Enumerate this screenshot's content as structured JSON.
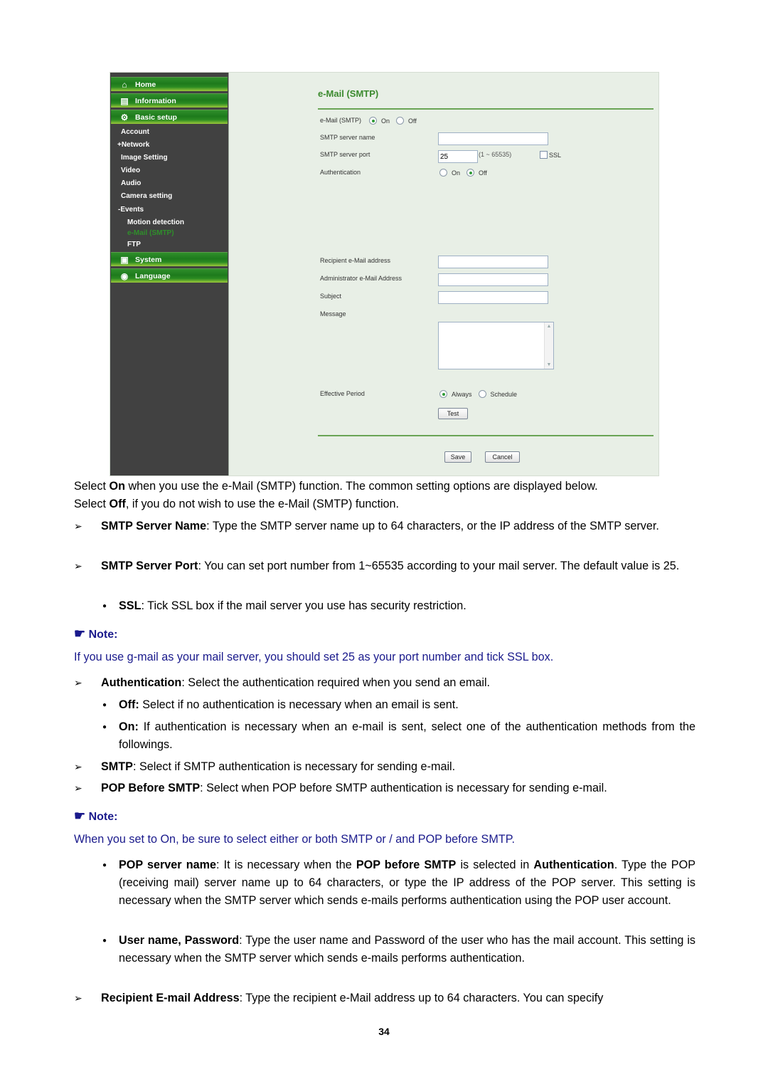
{
  "screenshot": {
    "sidebar": {
      "headers": [
        {
          "label": "Home",
          "icon": "home-icon",
          "glyph": "⌂"
        },
        {
          "label": "Information",
          "icon": "document-icon",
          "glyph": "▤"
        },
        {
          "label": "Basic setup",
          "icon": "gear-icon",
          "glyph": "⚙"
        },
        {
          "label": "System",
          "icon": "system-icon",
          "glyph": "▣"
        },
        {
          "label": "Language",
          "icon": "globe-icon",
          "glyph": "◉"
        }
      ],
      "items": [
        {
          "label": "Account"
        },
        {
          "label": "+Network"
        },
        {
          "label": "Image Setting"
        },
        {
          "label": "Video"
        },
        {
          "label": "Audio"
        },
        {
          "label": "Camera setting"
        },
        {
          "label": "-Events"
        },
        {
          "label": "Motion detection"
        },
        {
          "label": "e-Mail (SMTP)",
          "active": true
        },
        {
          "label": "FTP"
        }
      ],
      "active_color": "#2f8f2b"
    },
    "panel": {
      "title": "e-Mail (SMTP)",
      "email_smtp": {
        "label": "e-Mail (SMTP)",
        "options": [
          "On",
          "Off"
        ],
        "selected": "On"
      },
      "smtp_server_name": {
        "label": "SMTP server name",
        "value": ""
      },
      "smtp_server_port": {
        "label": "SMTP server port",
        "value": "25",
        "range": "(1 ~ 65535)"
      },
      "ssl": {
        "label": "SSL",
        "checked": false
      },
      "authentication": {
        "label": "Authentication",
        "options": [
          "On",
          "Off"
        ],
        "selected": "Off"
      },
      "recipient": {
        "label": "Recipient e-Mail address",
        "value": ""
      },
      "administrator": {
        "label": "Administrator e-Mail Address",
        "value": ""
      },
      "subject": {
        "label": "Subject",
        "value": ""
      },
      "message": {
        "label": "Message",
        "value": ""
      },
      "effective_period": {
        "label": "Effective Period",
        "options": [
          "Always",
          "Schedule"
        ],
        "selected": "Always"
      },
      "test_button": "Test",
      "save_button": "Save",
      "cancel_button": "Cancel"
    }
  },
  "doc": {
    "intro_1": [
      "Select ",
      "On",
      " when you use the e-Mail (SMTP) function. The common setting options are displayed below."
    ],
    "intro_2": [
      "Select ",
      "Off",
      ", if you do not wish to use the e-Mail (SMTP) function."
    ],
    "smtp_server_name": [
      "SMTP Server Name",
      ": Type the SMTP server name up to 64 characters, or the IP address of the SMTP server."
    ],
    "smtp_server_port": [
      "SMTP Server Port",
      ": You can set port number from 1~65535 according to your mail server. The default value is 25."
    ],
    "ssl": [
      "SSL",
      ": Tick SSL box if the mail server you use has security restriction."
    ],
    "note_label": "Note:",
    "note_1": "If you use g-mail as your mail server, you should set 25 as your port number and tick SSL box.",
    "authentication": [
      "Authentication",
      ": Select the authentication required when you send an email."
    ],
    "auth_off": [
      "Off:",
      " Select if no authentication is necessary when an email is sent."
    ],
    "auth_on": [
      "On:",
      " If authentication is necessary when an e-mail is sent, select one of the authentication methods from the followings."
    ],
    "smtp": [
      "SMTP",
      ": Select if SMTP authentication is necessary for sending e-mail."
    ],
    "pop_before_smtp": [
      "POP Before SMTP",
      ": Select when POP before SMTP authentication is necessary for sending e-mail."
    ],
    "note_2": "When you set to On, be sure to select either or both SMTP or / and POP before SMTP.",
    "pop_server_name": [
      "POP server name",
      ": It is necessary when the ",
      "POP before SMTP",
      " is selected in ",
      "Authentication",
      ". Type the POP (receiving mail) server name up to 64 characters, or type the IP address of the POP server. This setting is necessary when the SMTP server which sends e-mails performs authentication using the POP user account."
    ],
    "user_password": [
      "User name, Password",
      ": Type the user name and Password of the user who has the mail account. This setting is necessary when the SMTP server which sends e-mails performs authentication."
    ],
    "recipient": [
      "Recipient E-mail Address",
      ": Type the recipient e-Mail address up to 64 characters. You can specify"
    ],
    "arrow_marker": "➢",
    "bullet_marker": "●",
    "note_icon": "☛",
    "note_color": "#1a1a8c"
  },
  "page_number": "34"
}
